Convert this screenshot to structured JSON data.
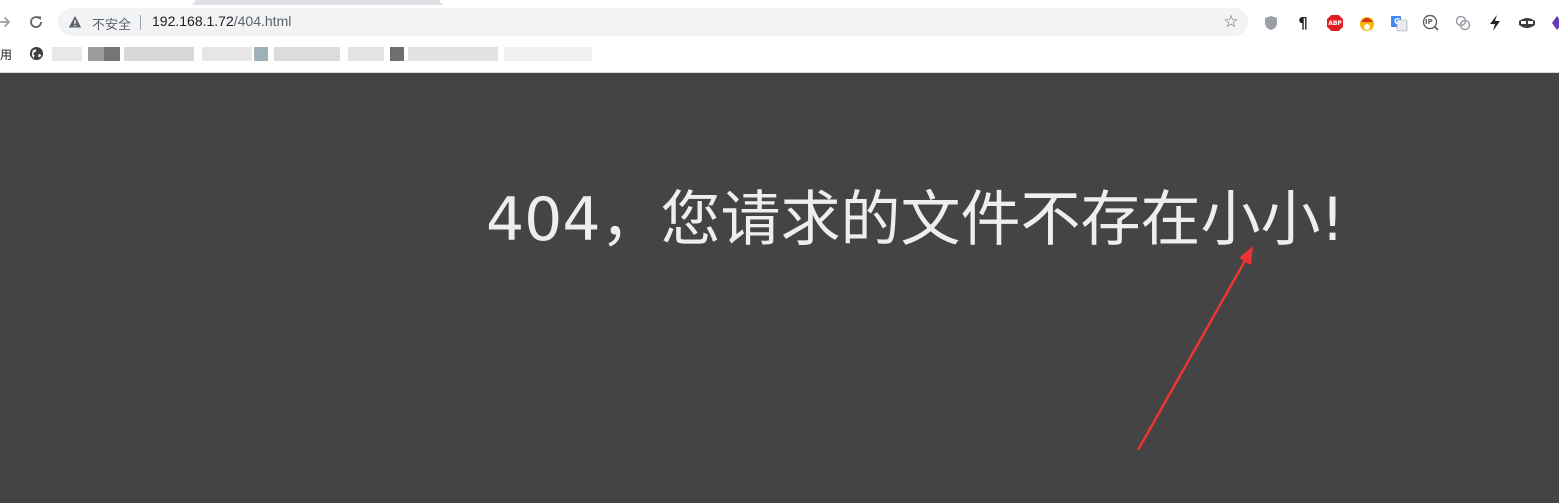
{
  "browser": {
    "security_label": "不安全",
    "url_host": "192.168.1.72",
    "url_path": "/404.html"
  },
  "extensions": [
    {
      "name": "shield-extension-icon",
      "glyph": "⬢",
      "color": "#9aa0a6"
    },
    {
      "name": "pilcrow-extension-icon",
      "glyph": "¶",
      "color": "#202124"
    },
    {
      "name": "adblock-plus-icon",
      "glyph": "ABP",
      "color": "#e51c24"
    },
    {
      "name": "santa-extension-icon",
      "glyph": "●",
      "color": "#d93025"
    },
    {
      "name": "google-translate-icon",
      "glyph": "G",
      "color": "#4285f4"
    },
    {
      "name": "ip-extension-icon",
      "glyph": "IP",
      "color": "#5f6368"
    },
    {
      "name": "rings-extension-icon",
      "glyph": "⚭",
      "color": "#9aa0a6"
    },
    {
      "name": "lightning-extension-icon",
      "glyph": "⚡",
      "color": "#202124"
    },
    {
      "name": "mask-extension-icon",
      "glyph": "◐",
      "color": "#202124"
    },
    {
      "name": "purple-extension-icon",
      "glyph": "◆",
      "color": "#673ab7"
    }
  ],
  "bookmarks": {
    "apps_label": "用"
  },
  "page": {
    "heading": "404，您请求的文件不存在小小!",
    "background_color": "#444444",
    "text_color": "#eeeeee"
  },
  "annotation": {
    "arrow_color": "#ee3333"
  }
}
